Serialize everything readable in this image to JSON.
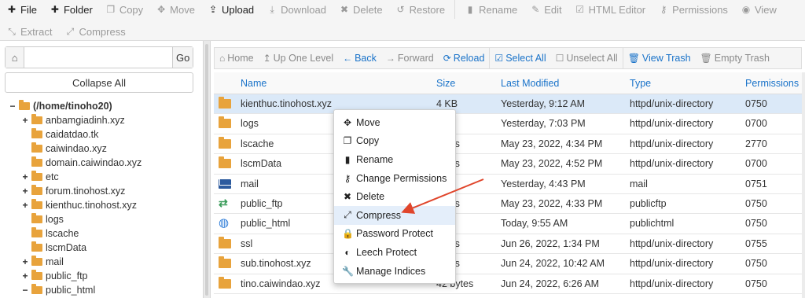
{
  "toolbar": {
    "row1": [
      {
        "icon": "plus-icon",
        "glyph": "✚",
        "label": "File",
        "enabled": true
      },
      {
        "icon": "plus-icon",
        "glyph": "✚",
        "label": "Folder",
        "enabled": true
      },
      {
        "icon": "copy-icon",
        "glyph": "❐",
        "label": "Copy",
        "enabled": false
      },
      {
        "icon": "move-icon",
        "glyph": "✥",
        "label": "Move",
        "enabled": false
      },
      {
        "icon": "upload-icon",
        "glyph": "⇪",
        "label": "Upload",
        "enabled": true
      },
      {
        "icon": "download-icon",
        "glyph": "⤓",
        "label": "Download",
        "enabled": false
      },
      {
        "icon": "delete-icon",
        "glyph": "✖",
        "label": "Delete",
        "enabled": false
      },
      {
        "icon": "restore-icon",
        "glyph": "↺",
        "label": "Restore",
        "enabled": false
      },
      {
        "icon": "rename-icon",
        "glyph": "▮",
        "label": "Rename",
        "enabled": false
      },
      {
        "icon": "edit-icon",
        "glyph": "✎",
        "label": "Edit",
        "enabled": false
      },
      {
        "icon": "html-editor-icon",
        "glyph": "☑",
        "label": "HTML Editor",
        "enabled": false
      },
      {
        "icon": "key-icon",
        "glyph": "⚷",
        "label": "Permissions",
        "enabled": false
      },
      {
        "icon": "eye-icon",
        "glyph": "◉",
        "label": "View",
        "enabled": false
      }
    ],
    "row2": [
      {
        "icon": "extract-icon",
        "glyph": "⤡",
        "label": "Extract",
        "enabled": false
      },
      {
        "icon": "compress-icon",
        "glyph": "⤢",
        "label": "Compress",
        "enabled": false
      }
    ]
  },
  "left": {
    "path_value": "",
    "go_label": "Go",
    "collapse_label": "Collapse All",
    "tree": [
      {
        "toggle": "−",
        "indent": 0,
        "label": "(/home/tinoho20)",
        "root": true
      },
      {
        "toggle": "+",
        "indent": 1,
        "label": "anbamgiadinh.xyz"
      },
      {
        "toggle": "",
        "indent": 1,
        "label": "caidatdao.tk"
      },
      {
        "toggle": "",
        "indent": 1,
        "label": "caiwindao.xyz"
      },
      {
        "toggle": "",
        "indent": 1,
        "label": "domain.caiwindao.xyz"
      },
      {
        "toggle": "+",
        "indent": 1,
        "label": "etc"
      },
      {
        "toggle": "+",
        "indent": 1,
        "label": "forum.tinohost.xyz"
      },
      {
        "toggle": "+",
        "indent": 1,
        "label": "kienthuc.tinohost.xyz"
      },
      {
        "toggle": "",
        "indent": 1,
        "label": "logs"
      },
      {
        "toggle": "",
        "indent": 1,
        "label": "lscache"
      },
      {
        "toggle": "",
        "indent": 1,
        "label": "lscmData"
      },
      {
        "toggle": "+",
        "indent": 1,
        "label": "mail"
      },
      {
        "toggle": "+",
        "indent": 1,
        "label": "public_ftp"
      },
      {
        "toggle": "−",
        "indent": 1,
        "label": "public_html"
      }
    ]
  },
  "nav": [
    {
      "icon": "home-icon",
      "glyph": "⌂",
      "label": "Home",
      "color": "grey"
    },
    {
      "icon": "up-arrow-icon",
      "glyph": "↥",
      "label": "Up One Level",
      "color": "grey"
    },
    {
      "icon": "back-arrow-icon",
      "glyph": "←",
      "label": "Back",
      "color": "blue"
    },
    {
      "icon": "forward-arrow-icon",
      "glyph": "→",
      "label": "Forward",
      "color": "grey"
    },
    {
      "icon": "reload-icon",
      "glyph": "⟳",
      "label": "Reload",
      "color": "blue"
    },
    {
      "icon": "checkbox-checked-icon",
      "glyph": "☑",
      "label": "Select All",
      "color": "blue"
    },
    {
      "icon": "checkbox-empty-icon",
      "glyph": "☐",
      "label": "Unselect All",
      "color": "grey"
    },
    {
      "icon": "trash-icon",
      "glyph": "🗑",
      "label": "View Trash",
      "color": "blue"
    },
    {
      "icon": "trash-icon",
      "glyph": "🗑",
      "label": "Empty Trash",
      "color": "grey"
    }
  ],
  "table": {
    "headers": {
      "name": "Name",
      "size": "Size",
      "modified": "Last Modified",
      "type": "Type",
      "perms": "Permissions"
    },
    "rows": [
      {
        "icon": "folder",
        "name": "kienthuc.tinohost.xyz",
        "size": "4 KB",
        "modified": "Yesterday, 9:12 AM",
        "type": "httpd/unix-directory",
        "perms": "0750",
        "selected": true
      },
      {
        "icon": "folder",
        "name": "logs",
        "size": "",
        "modified": "Yesterday, 7:03 PM",
        "type": "httpd/unix-directory",
        "perms": "0700"
      },
      {
        "icon": "folder",
        "name": "lscache",
        "size": "bytes",
        "modified": "May 23, 2022, 4:34 PM",
        "type": "httpd/unix-directory",
        "perms": "2770"
      },
      {
        "icon": "folder",
        "name": "lscmData",
        "size": "bytes",
        "modified": "May 23, 2022, 4:52 PM",
        "type": "httpd/unix-directory",
        "perms": "0700"
      },
      {
        "icon": "mail",
        "name": "mail",
        "size": "",
        "modified": "Yesterday, 4:43 PM",
        "type": "mail",
        "perms": "0751"
      },
      {
        "icon": "ftp",
        "name": "public_ftp",
        "size": "bytes",
        "modified": "May 23, 2022, 4:33 PM",
        "type": "publicftp",
        "perms": "0750"
      },
      {
        "icon": "globe",
        "name": "public_html",
        "size": "",
        "modified": "Today, 9:55 AM",
        "type": "publichtml",
        "perms": "0750"
      },
      {
        "icon": "folder",
        "name": "ssl",
        "size": "bytes",
        "modified": "Jun 26, 2022, 1:34 PM",
        "type": "httpd/unix-directory",
        "perms": "0755"
      },
      {
        "icon": "folder",
        "name": "sub.tinohost.xyz",
        "size": "bytes",
        "modified": "Jun 24, 2022, 10:42 AM",
        "type": "httpd/unix-directory",
        "perms": "0750"
      },
      {
        "icon": "folder",
        "name": "tino.caiwindao.xyz",
        "size": "42 bytes",
        "modified": "Jun 24, 2022, 6:26 AM",
        "type": "httpd/unix-directory",
        "perms": "0750"
      }
    ]
  },
  "context_menu": [
    {
      "icon": "move-icon",
      "glyph": "✥",
      "label": "Move"
    },
    {
      "icon": "copy-icon",
      "glyph": "❐",
      "label": "Copy"
    },
    {
      "icon": "file-icon",
      "glyph": "▮",
      "label": "Rename"
    },
    {
      "icon": "key-icon",
      "glyph": "⚷",
      "label": "Change Permissions"
    },
    {
      "icon": "delete-icon",
      "glyph": "✖",
      "label": "Delete"
    },
    {
      "icon": "compress-icon",
      "glyph": "⤢",
      "label": "Compress",
      "hover": true
    },
    {
      "icon": "lock-icon",
      "glyph": "🔒",
      "label": "Password Protect"
    },
    {
      "icon": "shield-icon",
      "glyph": "◐",
      "label": "Leech Protect"
    },
    {
      "icon": "wrench-icon",
      "glyph": "🔧",
      "label": "Manage Indices"
    }
  ],
  "colors": {
    "accent": "#1a73c9",
    "folder": "#e8a33c",
    "arrow": "#e0452b",
    "selected_row": "#dbe9f8"
  }
}
